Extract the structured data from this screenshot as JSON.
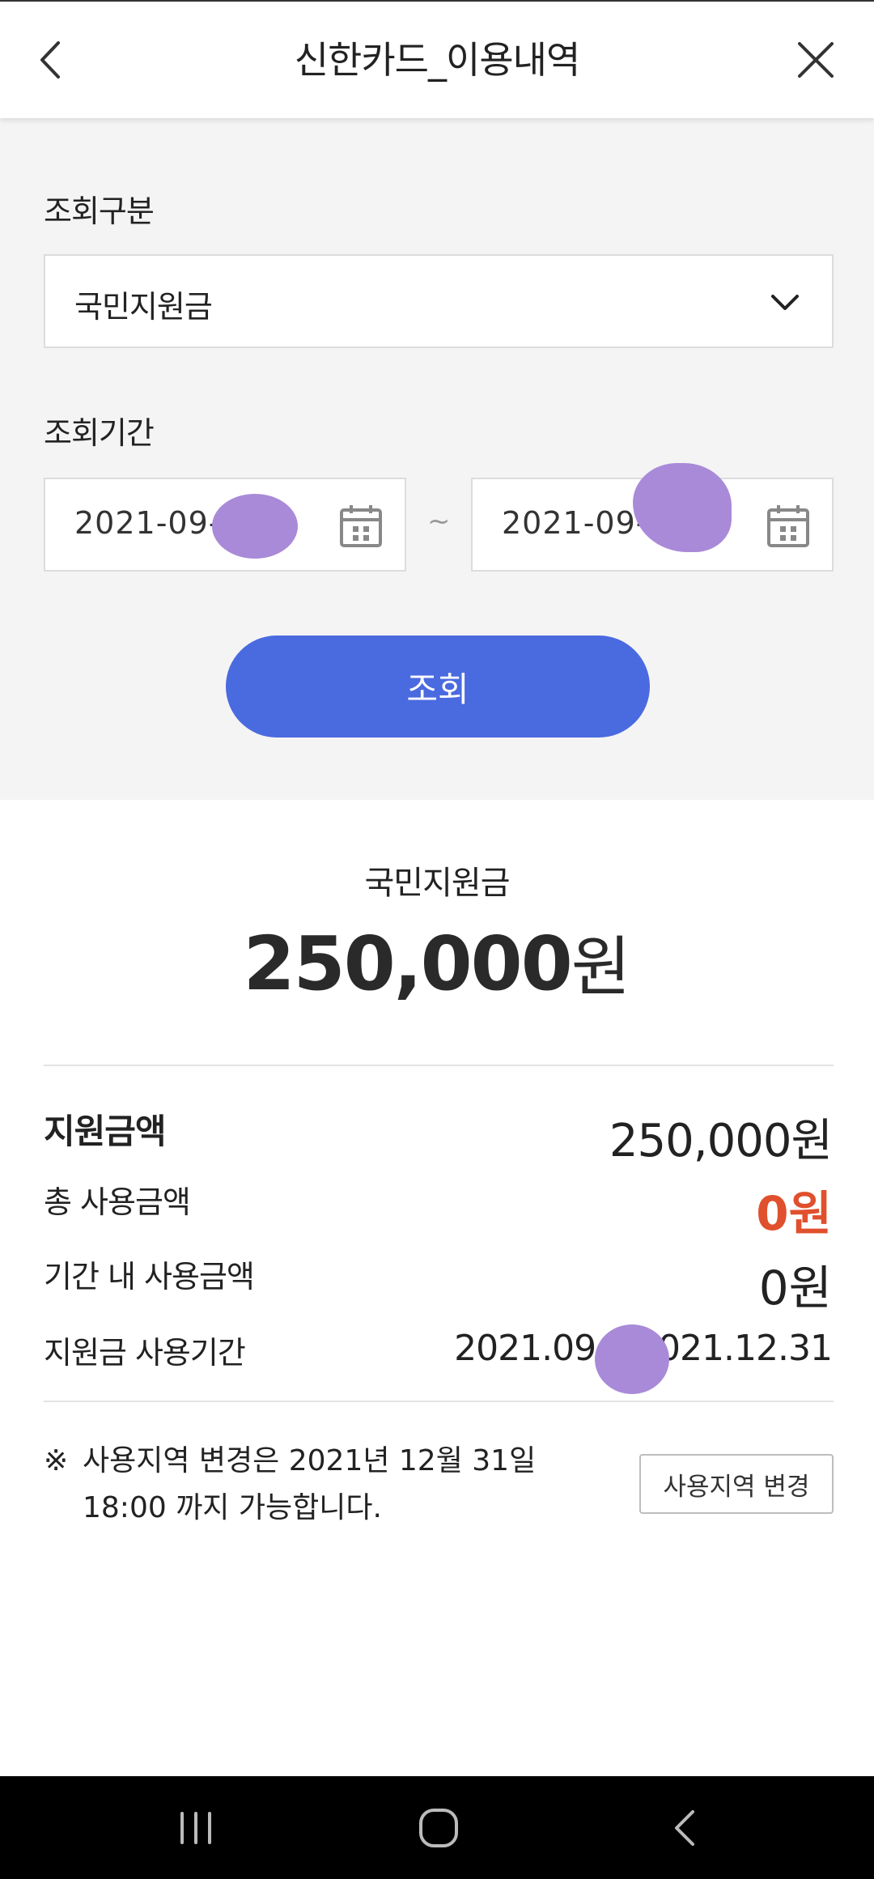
{
  "header": {
    "title": "신한카드_이용내역",
    "back_icon": "chevron-left-icon",
    "close_icon": "close-icon"
  },
  "search": {
    "category_label": "조회구분",
    "category_selected": "국민지원금",
    "period_label": "조회기간",
    "start_date": "2021-09-",
    "end_date": "2021-09-",
    "separator": "~",
    "search_button": "조회"
  },
  "summary": {
    "name": "국민지원금",
    "amount": "250,000",
    "unit": "원"
  },
  "details": {
    "support_amount_label": "지원금액",
    "support_amount_value": "250,000원",
    "total_used_label": "총 사용금액",
    "total_used_value": "0원",
    "period_used_label": "기간 내 사용금액",
    "period_used_value": "0원",
    "usage_period_label": "지원금 사용기간",
    "usage_period_start": "2021.09.0",
    "usage_period_end": "2021.12.31"
  },
  "notice": {
    "mark": "※",
    "text_line1": "사용지역 변경은 2021년 12월 31일",
    "text_line2": "18:00 까지 가능합니다.",
    "button": "사용지역 변경"
  },
  "colors": {
    "primary_button": "#4a6ae0",
    "accent_red": "#e0502d",
    "panel_bg": "#f4f4f4",
    "redaction": "#a98ad8"
  }
}
